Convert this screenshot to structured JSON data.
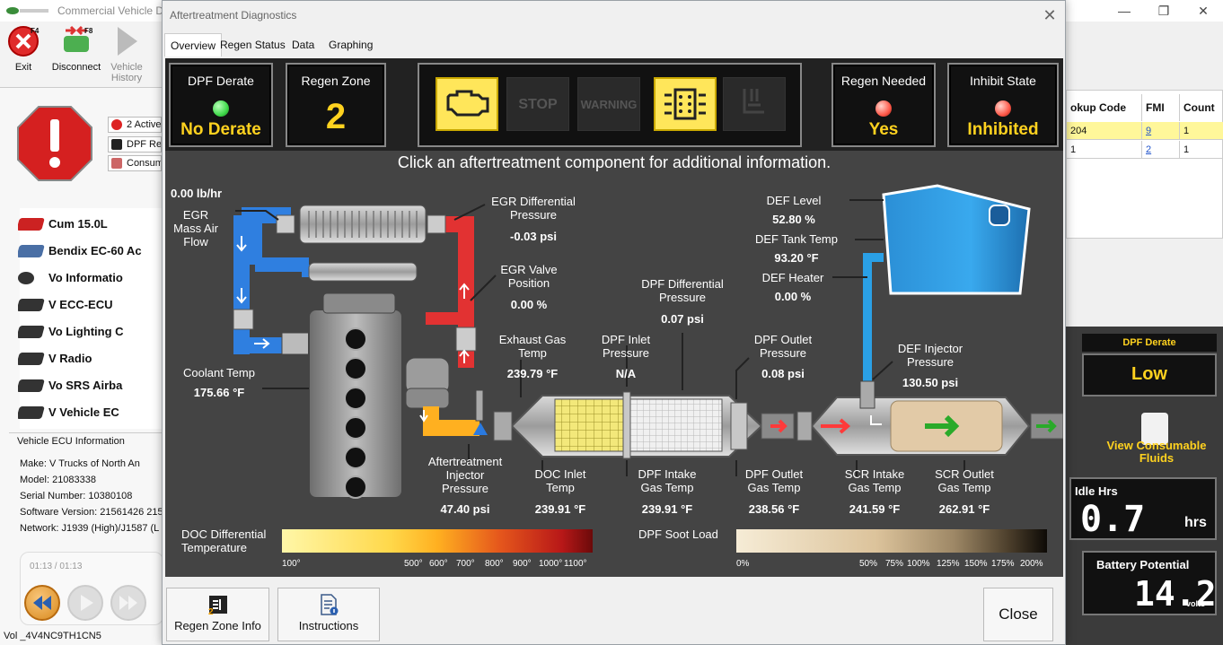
{
  "background_app": {
    "title": "Commercial Vehicle D",
    "toolbar": {
      "exit_label": "Exit",
      "exit_key": "F4",
      "disconnect_label": "Disconnect",
      "disconnect_key": "F8",
      "vehicle_history_line1": "Vehicle",
      "vehicle_history_line2": "History"
    },
    "fault_summary": [
      {
        "label": "2 Active"
      },
      {
        "label": "DPF Reg"
      },
      {
        "label": "Consum"
      }
    ],
    "ecu_list": [
      {
        "label": "Cum       15.0L"
      },
      {
        "label": "Bendix EC-60 Ac"
      },
      {
        "label": "Vo      Informatio"
      },
      {
        "label": "V       ECC-ECU"
      },
      {
        "label": "Vo      Lighting C"
      },
      {
        "label": "V       Radio"
      },
      {
        "label": "Vo      SRS Airba"
      },
      {
        "label": "V       Vehicle EC"
      }
    ],
    "vehicle_info": {
      "header": "Vehicle ECU Information",
      "lines": [
        "Make: V       Trucks of North An",
        "Model: 21083338",
        "Serial Number: 10380108",
        "Software Version: 21561426 215",
        "Network: J1939 (High)/J1587 (L"
      ]
    },
    "player_time": "01:13 / 01:13",
    "status_vin": "Vol              _4V4NC9TH1CN5"
  },
  "fault_table": {
    "headers": [
      "okup Code",
      "FMI",
      "Count"
    ],
    "rows": [
      [
        "204",
        "9",
        "1"
      ],
      [
        "1",
        "2",
        "1"
      ]
    ]
  },
  "right_gauges": {
    "dpf_derate_label": "DPF Derate",
    "dpf_derate_value": "Low",
    "consumable_line1": "View Consumable",
    "consumable_line2": "Fluids",
    "idle_label": "Idle Hrs",
    "idle_value": "0.7",
    "idle_unit": "hrs",
    "battery_label": "Battery Potential",
    "battery_value": "14.2",
    "battery_unit": "volts"
  },
  "dialog": {
    "title": "Aftertreatment Diagnostics",
    "tabs": [
      "Overview",
      "Regen Status",
      "Data",
      "Graphing"
    ],
    "status": {
      "dpf_derate_title": "DPF Derate",
      "dpf_derate_value": "No Derate",
      "regen_zone_title": "Regen Zone",
      "regen_zone_value": "2",
      "regen_needed_title": "Regen Needed",
      "regen_needed_value": "Yes",
      "inhibit_state_title": "Inhibit State",
      "inhibit_state_value": "Inhibited",
      "lamps": [
        "check-engine",
        "STOP",
        "WARNING",
        "DPF",
        "HEST"
      ]
    },
    "click_message": "Click an aftertreatment component for additional information.",
    "readings": {
      "maf_value": "0.00 lb/hr",
      "maf_label": "EGR\nMass Air\nFlow",
      "egr_diff_label": "EGR Differential\nPressure",
      "egr_diff_value": "-0.03 psi",
      "egr_valve_label": "EGR Valve\nPosition",
      "egr_valve_value": "0.00 %",
      "coolant_label": "Coolant Temp",
      "coolant_value": "175.66 °F",
      "exh_gas_label": "Exhaust Gas\nTemp",
      "exh_gas_value": "239.79 °F",
      "dpf_inlet_label": "DPF Inlet\nPressure",
      "dpf_inlet_value": "N/A",
      "dpf_diff_label": "DPF Differential\nPressure",
      "dpf_diff_value": "0.07 psi",
      "dpf_outlet_p_label": "DPF Outlet\nPressure",
      "dpf_outlet_p_value": "0.08 psi",
      "def_level_label": "DEF Level",
      "def_level_value": "52.80 %",
      "def_tank_label": "DEF Tank Temp",
      "def_tank_value": "93.20 °F",
      "def_heater_label": "DEF Heater",
      "def_heater_value": "0.00 %",
      "def_inj_label": "DEF Injector\nPressure",
      "def_inj_value": "130.50 psi",
      "at_inj_label": "Aftertreatment\nInjector\nPressure",
      "at_inj_value": "47.40 psi",
      "doc_inlet_label": "DOC Inlet\nTemp",
      "doc_inlet_value": "239.91 °F",
      "dpf_intake_label": "DPF Intake\nGas Temp",
      "dpf_intake_value": "239.91 °F",
      "dpf_outlet_t_label": "DPF Outlet\nGas Temp",
      "dpf_outlet_t_value": "238.56 °F",
      "scr_intake_label": "SCR Intake\nGas Temp",
      "scr_intake_value": "241.59 °F",
      "scr_outlet_label": "SCR Outlet\nGas Temp",
      "scr_outlet_value": "262.91 °F"
    },
    "legend_left": {
      "label": "DOC Differential\nTemperature",
      "ticks": [
        "100°",
        "500°",
        "600°",
        "700°",
        "800°",
        "900°",
        "1000°",
        "1100°"
      ]
    },
    "legend_right": {
      "label": "DPF Soot Load",
      "ticks": [
        "0%",
        "50%",
        "75%",
        "100%",
        "125%",
        "150%",
        "175%",
        "200%"
      ]
    },
    "buttons": {
      "regen_zone_info": "Regen Zone Info",
      "instructions": "Instructions",
      "close": "Close"
    }
  },
  "colors": {
    "status_yellow": "#ffd21f",
    "led_green": "#3fd94a",
    "led_red": "#ff5a4a",
    "def_blue": "#2aa0e6",
    "egr_red": "#e23232",
    "egr_blue": "#2f7fe0"
  }
}
